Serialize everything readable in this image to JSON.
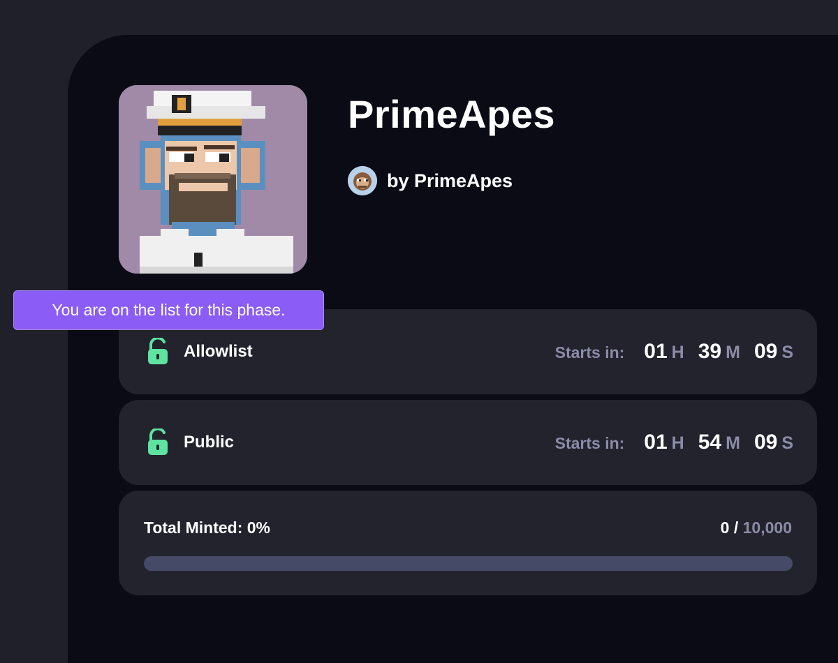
{
  "collection": {
    "title": "PrimeApes",
    "creator_text": "by PrimeApes"
  },
  "tooltip": {
    "text": "You are on the list for this phase."
  },
  "phases": [
    {
      "name": "Allowlist",
      "starts_label": "Starts in:",
      "hours": "01",
      "hours_unit": "H",
      "minutes": "39",
      "minutes_unit": "M",
      "seconds": "09",
      "seconds_unit": "S"
    },
    {
      "name": "Public",
      "starts_label": "Starts in:",
      "hours": "01",
      "hours_unit": "H",
      "minutes": "54",
      "minutes_unit": "M",
      "seconds": "09",
      "seconds_unit": "S"
    }
  ],
  "minting": {
    "label": "Total Minted: 0%",
    "minted": "0",
    "separator": " / ",
    "max": "10,000",
    "progress_percent": 0
  },
  "icons": {
    "phase_icon": "unlock-icon",
    "creator_icon": "creator-avatar-icon"
  },
  "colors": {
    "accent": "#8b5cf6",
    "unlock": "#5fe3a1",
    "muted_text": "#8a8ca8"
  }
}
